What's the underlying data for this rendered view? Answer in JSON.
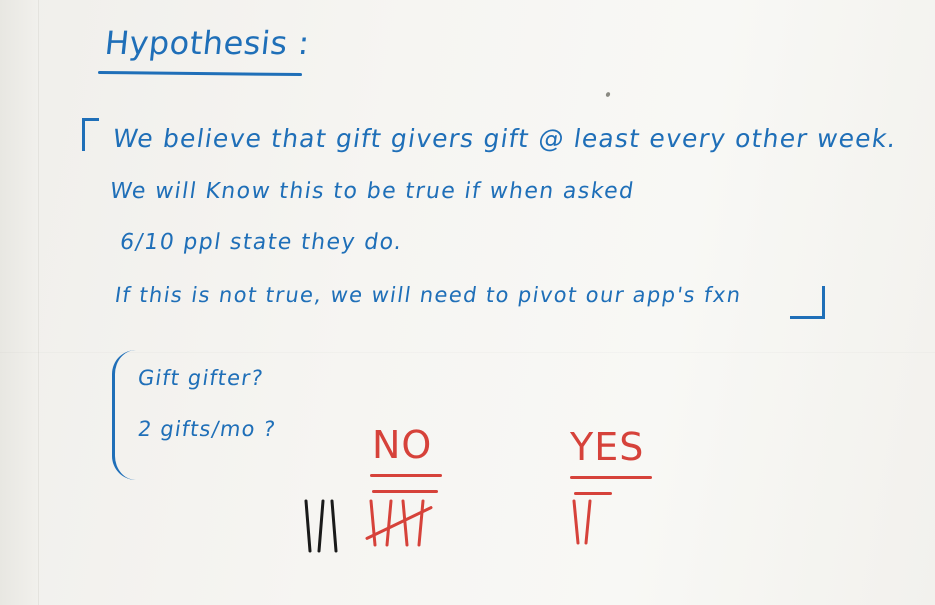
{
  "whiteboard": {
    "title": "Hypothesis :",
    "hypothesis_lines": [
      "We believe that gift givers gift @ least every other week.",
      "We will Know this to be true if when asked",
      "6/10 ppl state they do.",
      "If this is not true, we will need to pivot our app's fxn"
    ],
    "questions": [
      "Gift gifter?",
      "2 gifts/mo ?"
    ],
    "tally": {
      "no_label": "NO",
      "yes_label": "YES",
      "gifter_count": 3,
      "no_count": 5,
      "yes_count": 2
    },
    "colors": {
      "blue_marker": "#1f6fb8",
      "red_marker": "#d6423a",
      "black_marker": "#1a1a1a"
    }
  }
}
